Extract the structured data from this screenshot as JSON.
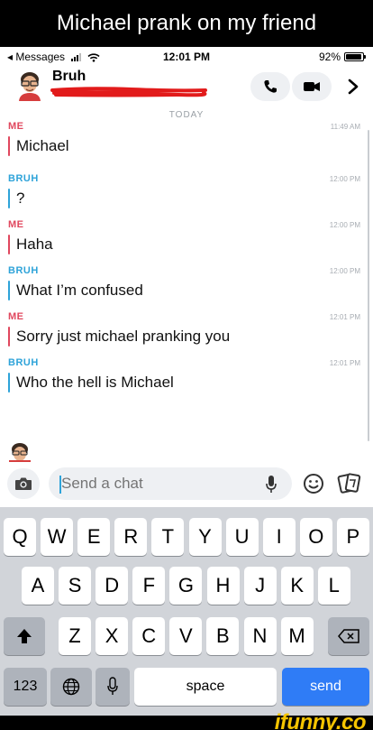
{
  "caption": "Michael prank on my friend",
  "status": {
    "back": "◂ Messages",
    "time": "12:01 PM",
    "battery": "92%",
    "battery_level": 0.92
  },
  "header": {
    "name": "Bruh"
  },
  "chat": {
    "day": "TODAY",
    "messages": [
      {
        "sender": "ME",
        "kind": "me",
        "time": "11:49 AM",
        "text": "Michael"
      },
      {
        "sender": "BRUH",
        "kind": "bruh",
        "time": "12:00 PM",
        "text": "?"
      },
      {
        "sender": "ME",
        "kind": "me",
        "time": "12:00 PM",
        "text": "Haha"
      },
      {
        "sender": "BRUH",
        "kind": "bruh",
        "time": "12:00 PM",
        "text": "What I’m confused"
      },
      {
        "sender": "ME",
        "kind": "me",
        "time": "12:01 PM",
        "text": "Sorry just michael pranking you"
      },
      {
        "sender": "BRUH",
        "kind": "bruh",
        "time": "12:01 PM",
        "text": "Who the hell is Michael"
      }
    ]
  },
  "input": {
    "placeholder": "Send a chat"
  },
  "keyboard": {
    "row1": [
      "Q",
      "W",
      "E",
      "R",
      "T",
      "Y",
      "U",
      "I",
      "O",
      "P"
    ],
    "row2": [
      "A",
      "S",
      "D",
      "F",
      "G",
      "H",
      "J",
      "K",
      "L"
    ],
    "row3": [
      "Z",
      "X",
      "C",
      "V",
      "B",
      "N",
      "M"
    ],
    "numbers": "123",
    "space": "space",
    "send": "send"
  },
  "watermark": "ifunny.co",
  "colors": {
    "me": "#e0475e",
    "bruh": "#2ea3d9",
    "send": "#2f7cf6"
  }
}
